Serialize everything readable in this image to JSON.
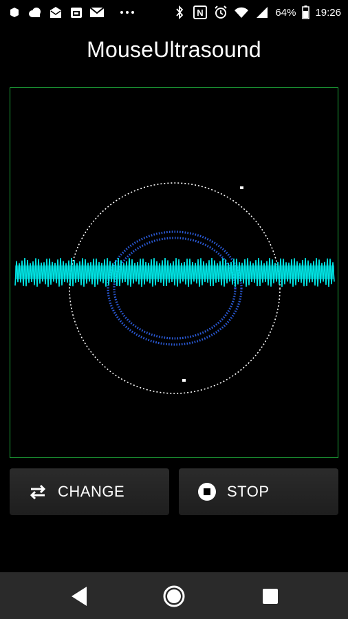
{
  "status_bar": {
    "battery_percent": "64%",
    "time": "19:26",
    "left_icons": [
      "app-notification-icon",
      "cloud-icon",
      "mail-icon",
      "calendar-icon",
      "gmail-icon",
      "more-icon"
    ],
    "right_icons": [
      "bluetooth-icon",
      "nfc-icon",
      "alarm-icon",
      "wifi-icon",
      "signal-icon",
      "battery-icon"
    ]
  },
  "app": {
    "title": "MouseUltrasound"
  },
  "scope": {
    "border_color": "#1ea83a",
    "waveform_color": "#00e5e5",
    "inner_rings_color": "#2a5ad6",
    "outer_ring_color": "#ffffff"
  },
  "buttons": {
    "change_label": "CHANGE",
    "stop_label": "STOP"
  },
  "nav_bar": {
    "icons": [
      "back-icon",
      "home-icon",
      "recents-icon"
    ]
  }
}
